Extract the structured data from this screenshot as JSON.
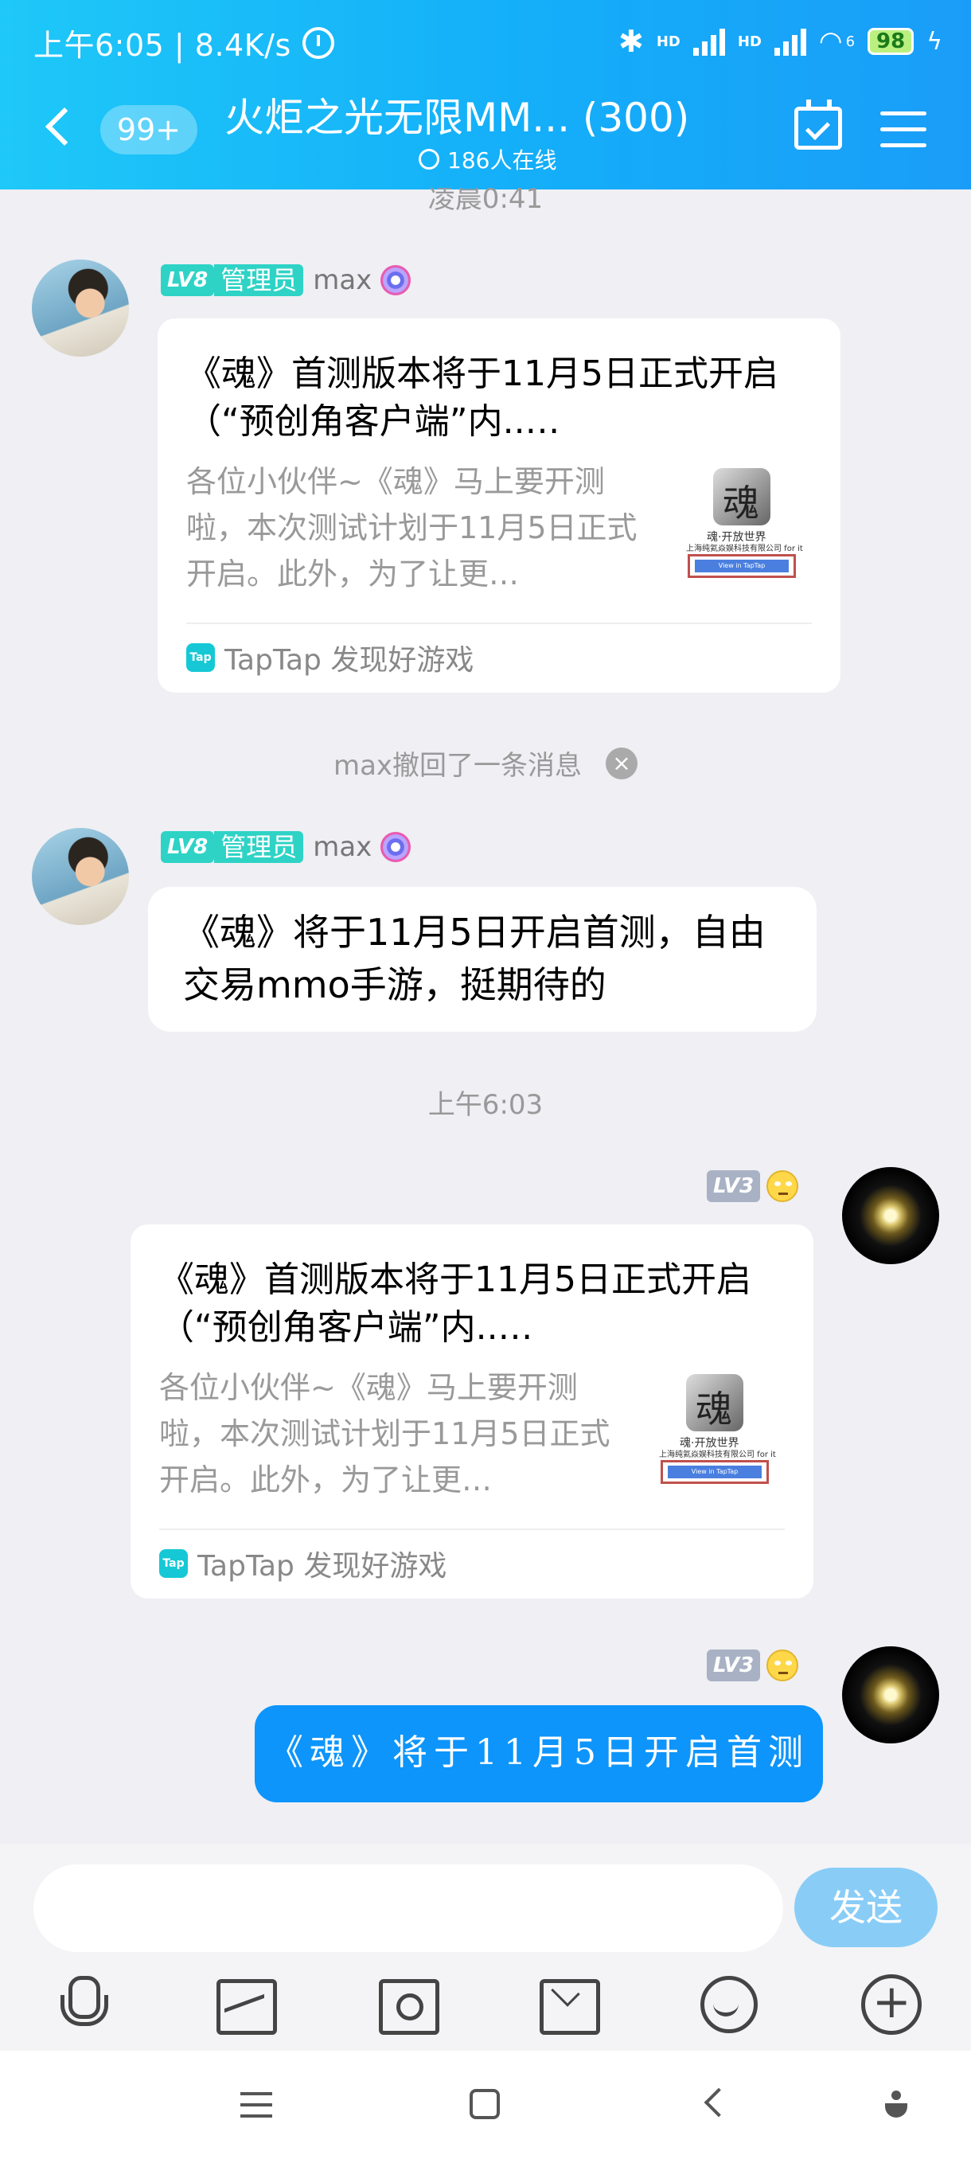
{
  "status_bar": {
    "time_speed": "上午6:05 | 8.4K/s",
    "battery": "98",
    "hd1": "HD",
    "hd2": "HD",
    "wifi_sub": "6"
  },
  "header": {
    "unread_badge": "99+",
    "title": "火炬之光无限MM... (300)",
    "online": "186人在线"
  },
  "messages": {
    "time_top": "凌晨0:41",
    "msg1": {
      "level": "LV8",
      "role": "管理员",
      "name": "max",
      "card_title": "《魂》首测版本将于11月5日正式开启（“预创角客户端”内..…",
      "card_desc": "各位小伙伴~《魂》马上要开测啦，本次测试计划于11月5日正式开启。此外，为了让更…",
      "thumb_line1": "魂·开放世界",
      "thumb_line2": "上海纯氦焱娱科技有限公司 for it",
      "source": "TapTap 发现好游戏",
      "source_icon": "Tap"
    },
    "recall": "max撤回了一条消息",
    "msg2": {
      "level": "LV8",
      "role": "管理员",
      "name": "max",
      "text": "《魂》将于11月5日开启首测，自由交易mmo手游，挺期待的"
    },
    "time_mid": "上午6:03",
    "msg3": {
      "level": "LV3",
      "card_title": "《魂》首测版本将于11月5日正式开启（“预创角客户端”内..…",
      "card_desc": "各位小伙伴~《魂》马上要开测啦，本次测试计划于11月5日正式开启。此外，为了让更…",
      "thumb_line1": "魂·开放世界",
      "thumb_line2": "上海纯氦焱娱科技有限公司 for it",
      "source": "TapTap 发现好游戏",
      "source_icon": "Tap"
    },
    "msg4": {
      "level": "LV3",
      "text": "《魂》将于11月5日开启首测"
    }
  },
  "input": {
    "placeholder": "",
    "send_label": "发送"
  },
  "colors": {
    "header_start": "#1ec8f8",
    "header_end": "#1a9df8",
    "my_bubble": "#0d95fb",
    "send_btn": "#89cdf7",
    "lv8": "#2ed3c6",
    "lv3": "#a9b2c4"
  },
  "icons": {
    "toolbar": [
      "microphone-icon",
      "image-icon",
      "camera-icon",
      "red-packet-icon",
      "emoji-icon",
      "plus-icon"
    ],
    "navbar": [
      "menu-icon",
      "home-icon",
      "back-icon",
      "accessibility-icon"
    ]
  }
}
